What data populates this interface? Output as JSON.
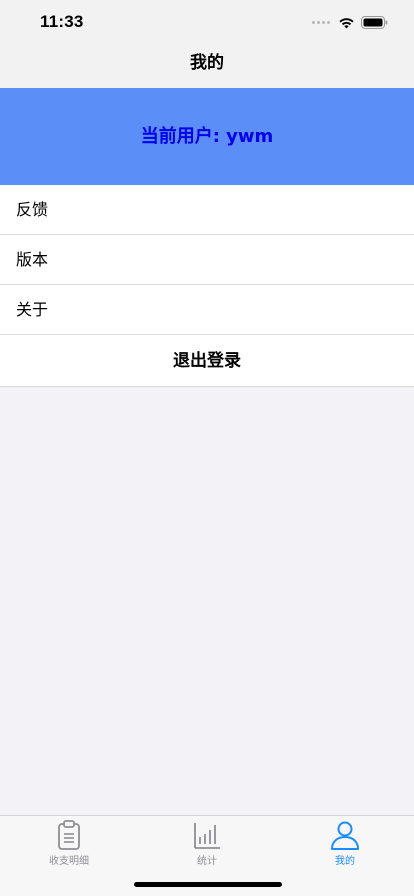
{
  "status_bar": {
    "time": "11:33"
  },
  "nav": {
    "title": "我的"
  },
  "banner": {
    "user_text": "当前用户: ywm",
    "background_color": "#5b8ef7",
    "text_color": "#0000ee"
  },
  "menu": {
    "items": [
      {
        "label": "反馈"
      },
      {
        "label": "版本"
      },
      {
        "label": "关于"
      }
    ],
    "logout_label": "退出登录"
  },
  "tabs": [
    {
      "label": "收支明细",
      "icon": "clipboard-icon",
      "active": false
    },
    {
      "label": "统计",
      "icon": "bar-chart-icon",
      "active": false
    },
    {
      "label": "我的",
      "icon": "person-icon",
      "active": true
    }
  ],
  "colors": {
    "tab_active": "#1a8cff",
    "tab_inactive": "#8e8e93"
  }
}
